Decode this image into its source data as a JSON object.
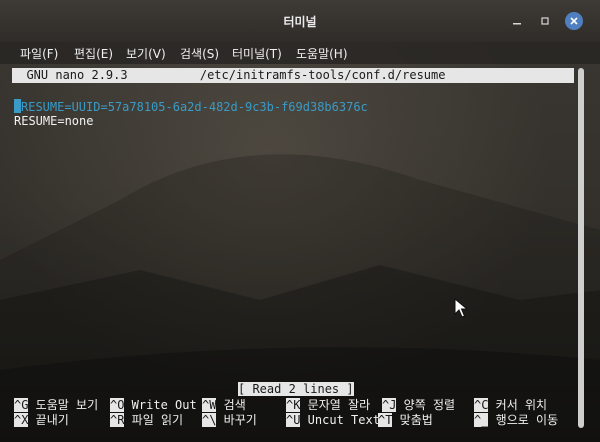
{
  "window": {
    "title": "터미널"
  },
  "menubar": {
    "items": [
      "파일(F)",
      "편집(E)",
      "보기(V)",
      "검색(S)",
      "터미널(T)",
      "도움말(H)"
    ]
  },
  "nano": {
    "header": "  GNU nano 2.9.3          /etc/initramfs-tools/conf.d/resume",
    "lines": [
      {
        "cursor_char": "#",
        "text": "RESUME=UUID=57a78105-6a2d-482d-9c3b-f69d38b6376c"
      },
      {
        "text": "RESUME=none"
      }
    ],
    "status": "[ Read 2 lines ]",
    "shortcuts_row1": [
      {
        "key": "^G",
        "label": " 도움말 보기"
      },
      {
        "key": "^O",
        "label": " Write Out"
      },
      {
        "key": "^W",
        "label": " 검색"
      },
      {
        "key": "^K",
        "label": " 문자열 잘라"
      },
      {
        "key": "^J",
        "label": " 양쪽 정렬"
      },
      {
        "key": "^C",
        "label": " 커서 위치"
      }
    ],
    "shortcuts_row2": [
      {
        "key": "^X",
        "label": " 끝내기"
      },
      {
        "key": "^R",
        "label": " 파일 읽기"
      },
      {
        "key": "^\\",
        "label": " 바꾸기"
      },
      {
        "key": "^U",
        "label": " Uncut Text"
      },
      {
        "key": "^T",
        "label": " 맞춤법"
      },
      {
        "key": "^_",
        "label": " 행으로 이동"
      }
    ]
  },
  "colors": {
    "comment": "#3a9bc6",
    "header_bg": "#e6e6e6",
    "close_button": "#4f7fbe"
  },
  "icons": {
    "minimize": "minimize-icon",
    "restore": "restore-icon",
    "close": "close-icon",
    "pointer": "mouse-pointer-icon"
  }
}
